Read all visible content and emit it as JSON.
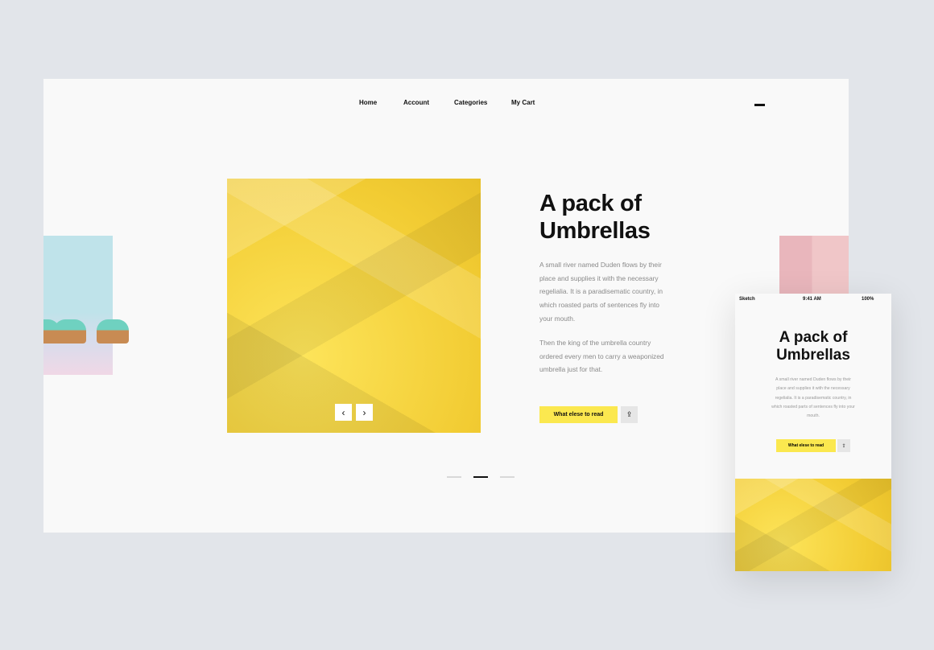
{
  "nav": {
    "items": [
      "Home",
      "Account",
      "Categories",
      "My Cart"
    ]
  },
  "hero": {
    "title_line1": "A pack of",
    "title_line2": "Umbrellas",
    "paragraph1": "A small river named Duden flows by their place and supplies it with the necessary regelialia. It is a paradisematic country, in which roasted parts of sentences fly into your mouth.",
    "paragraph2": "Then the king of the umbrella country ordered every men to carry a weaponized umbrella just for that.",
    "cta": "What elese to read",
    "prev": "‹",
    "next": "›",
    "share": "⇪"
  },
  "pagination": {
    "count": 3,
    "active": 2
  },
  "colors": {
    "accent": "#fbe84f",
    "background": "#e2e5ea"
  },
  "phone": {
    "carrier": "Sketch",
    "time": "9:41 AM",
    "battery": "100%"
  }
}
